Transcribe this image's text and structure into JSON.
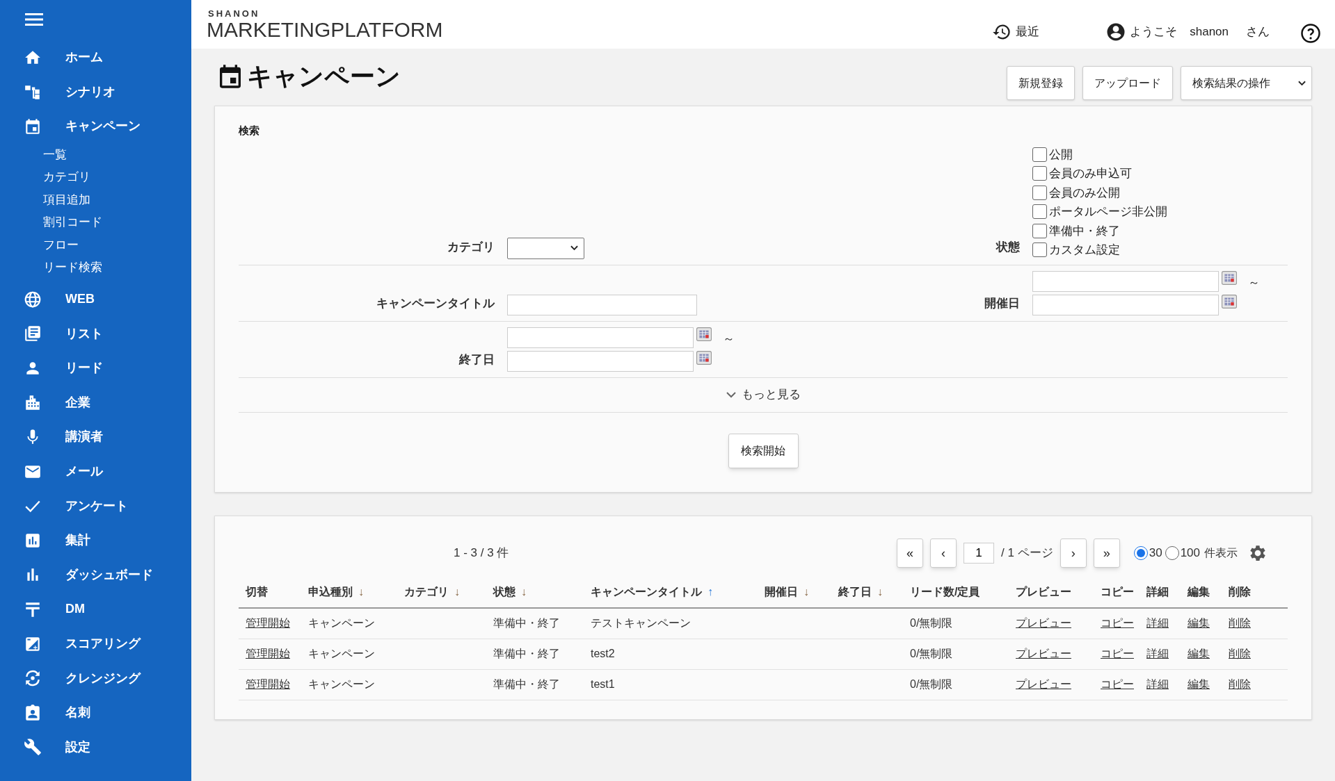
{
  "sidebar": {
    "items": [
      {
        "label": "ホーム"
      },
      {
        "label": "シナリオ"
      },
      {
        "label": "キャンペーン",
        "children": [
          {
            "label": "一覧"
          },
          {
            "label": "カテゴリ"
          },
          {
            "label": "項目追加"
          },
          {
            "label": "割引コード"
          },
          {
            "label": "フロー"
          },
          {
            "label": "リード検索"
          }
        ]
      },
      {
        "label": "WEB"
      },
      {
        "label": "リスト"
      },
      {
        "label": "リード"
      },
      {
        "label": "企業"
      },
      {
        "label": "講演者"
      },
      {
        "label": "メール"
      },
      {
        "label": "アンケート"
      },
      {
        "label": "集計"
      },
      {
        "label": "ダッシュボード"
      },
      {
        "label": "DM"
      },
      {
        "label": "スコアリング"
      },
      {
        "label": "クレンジング"
      },
      {
        "label": "名刺"
      },
      {
        "label": "設定"
      }
    ]
  },
  "header": {
    "logo_top": "SHANON",
    "logo_main": "MARKETINGPLATFORM",
    "recent": "最近",
    "welcome": "ようこそ",
    "user": "shanon",
    "honorific": "さん"
  },
  "page": {
    "title": "キャンペーン",
    "buttons": [
      "新規登録",
      "アップロード"
    ],
    "action_select": "検索結果の操作"
  },
  "search": {
    "title": "検索",
    "category_label": "カテゴリ",
    "status_label": "状態",
    "statuses": [
      {
        "label": "公開",
        "checked": false
      },
      {
        "label": "会員のみ申込可",
        "checked": false
      },
      {
        "label": "会員のみ公開",
        "checked": false
      },
      {
        "label": "ポータルページ非公開",
        "checked": false
      },
      {
        "label": "準備中・終了",
        "checked": false
      },
      {
        "label": "カスタム設定",
        "checked": false
      }
    ],
    "title_label": "キャンペーンタイトル",
    "event_date_label": "開催日",
    "end_date_label": "終了日",
    "range_sep": "～",
    "more": "もっと見る",
    "submit": "検索開始"
  },
  "results": {
    "count": "1 - 3 / 3 件",
    "pager": {
      "first": "«",
      "prev": "‹",
      "page": "1",
      "total": "/ 1 ページ",
      "next": "›",
      "last": "»"
    },
    "per_page": [
      {
        "label": "30",
        "selected": true
      },
      {
        "label": "100",
        "selected": false
      }
    ],
    "per_page_suffix": "件表示",
    "columns": [
      {
        "label": "切替"
      },
      {
        "label": "申込種別",
        "arrow": "↓",
        "kind": "inactive"
      },
      {
        "label": "カテゴリ",
        "arrow": "↓",
        "kind": "inactive"
      },
      {
        "label": "状態",
        "arrow": "↓",
        "kind": "inactive"
      },
      {
        "label": "キャンペーンタイトル",
        "arrow": "↑",
        "kind": "active"
      },
      {
        "label": "開催日",
        "arrow": "↓",
        "kind": "inactive"
      },
      {
        "label": "終了日",
        "arrow": "↓",
        "kind": "inactive"
      },
      {
        "label": "リード数/定員"
      },
      {
        "label": "プレビュー"
      },
      {
        "label": "コピー"
      },
      {
        "label": "詳細"
      },
      {
        "label": "編集"
      },
      {
        "label": "削除"
      }
    ],
    "rows": [
      {
        "toggle": "管理開始",
        "type": "キャンペーン",
        "status": "準備中・終了",
        "title": "テストキャンペーン",
        "leads": "0/無制限",
        "preview": "プレビュー",
        "copy": "コピー",
        "detail": "詳細",
        "edit": "編集",
        "delete": "削除"
      },
      {
        "toggle": "管理開始",
        "type": "キャンペーン",
        "status": "準備中・終了",
        "title": "test2",
        "leads": "0/無制限",
        "preview": "プレビュー",
        "copy": "コピー",
        "detail": "詳細",
        "edit": "編集",
        "delete": "削除"
      },
      {
        "toggle": "管理開始",
        "type": "キャンペーン",
        "status": "準備中・終了",
        "title": "test1",
        "leads": "0/無制限",
        "preview": "プレビュー",
        "copy": "コピー",
        "detail": "詳細",
        "edit": "編集",
        "delete": "削除"
      }
    ]
  }
}
